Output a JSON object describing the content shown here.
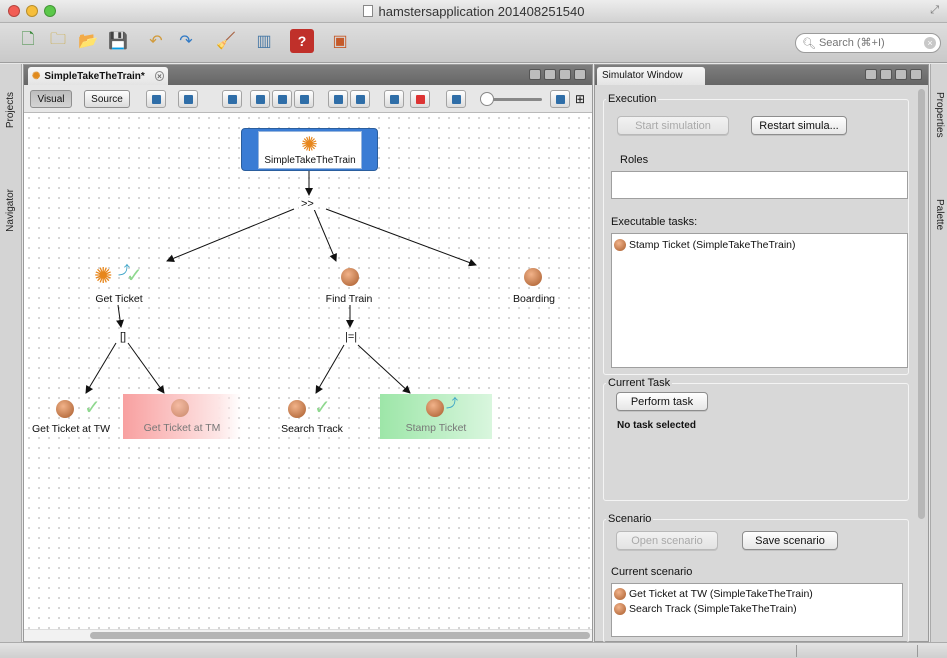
{
  "window": {
    "title": "hamstersapplication 201408251540"
  },
  "search": {
    "placeholder": "Search (⌘+I)"
  },
  "left_tabs": [
    "Projects",
    "Navigator"
  ],
  "right_tabs": [
    "Properties",
    "Palette"
  ],
  "editor": {
    "tab_label": "SimpleTakeTheTrain*",
    "view_buttons": [
      "Visual",
      "Source"
    ],
    "tree": {
      "root": "SimpleTakeTheTrain",
      "root_operator": ">>",
      "children": [
        {
          "label": "Get Ticket",
          "operator": "[]",
          "children": [
            "Get Ticket at TW",
            "Get Ticket at TM"
          ]
        },
        {
          "label": "Find Train",
          "operator": "|=|",
          "children": [
            "Search Track",
            "Stamp Ticket"
          ]
        },
        {
          "label": "Boarding"
        }
      ]
    }
  },
  "simulator": {
    "tab_label": "Simulator Window",
    "execution": {
      "legend": "Execution",
      "start_button": "Start simulation",
      "restart_button": "Restart simula...",
      "roles_label": "Roles",
      "executable_label": "Executable tasks:",
      "executable_tasks": [
        "Stamp Ticket (SimpleTakeTheTrain)"
      ]
    },
    "current_task": {
      "legend": "Current Task",
      "perform_button": "Perform task",
      "status": "No task selected"
    },
    "scenario": {
      "legend": "Scenario",
      "open_button": "Open scenario",
      "save_button": "Save scenario",
      "current_label": "Current scenario",
      "items": [
        "Get Ticket at TW (SimpleTakeTheTrain)",
        "Search Track (SimpleTakeTheTrain)"
      ]
    }
  },
  "colors": {
    "root_node": "#3a7cd4",
    "disabled_node": "#f8a0a0",
    "enabled_node": "#9de6a8",
    "check": "#7fd37f"
  }
}
